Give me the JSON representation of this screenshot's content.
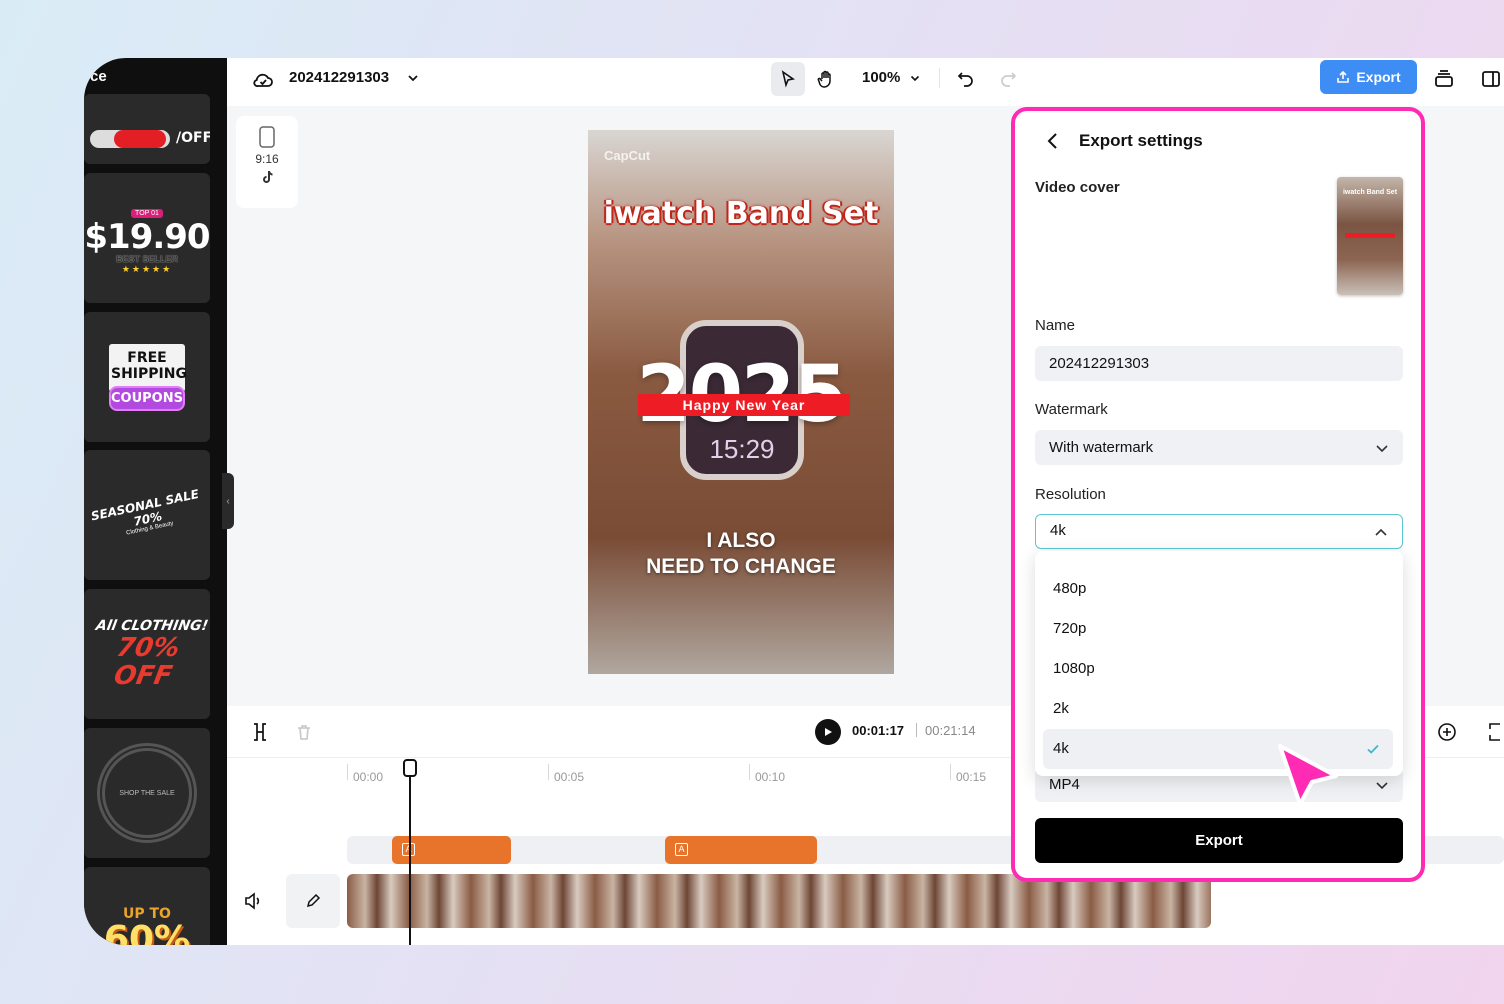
{
  "brand_fragment": "ce",
  "assets": [
    {
      "line1": "/OFF",
      "line2": ""
    },
    {
      "line1": "$19.90",
      "line2": "BEST SELLER"
    },
    {
      "line1": "FREE SHIPPING",
      "line2": "COUPONS"
    },
    {
      "line1": "SEASONAL SALE 70%",
      "line2": "Clothing & Beauty"
    },
    {
      "line1": "All CLOTHING!",
      "line2": "70% OFF"
    },
    {
      "line1": "SHOP THE SALE",
      "line2": ""
    },
    {
      "line1": "UP TO",
      "line2": "60%"
    }
  ],
  "topbar": {
    "project_name": "202412291303",
    "zoom": "100%",
    "export_label": "Export"
  },
  "ratio": {
    "label": "9:16"
  },
  "preview": {
    "watermark": "CapCut",
    "title": "iwatch Band Set",
    "year": "2025",
    "banner": "Happy New Year",
    "watch_time": "15:29",
    "caption_line1": "I ALSO",
    "caption_line2": "NEED TO CHANGE"
  },
  "timeline": {
    "current_time": "00:01:17",
    "total_time": "00:21:14",
    "ruler": [
      "00:00",
      "00:05",
      "00:10",
      "00:15"
    ]
  },
  "export_panel": {
    "title": "Export settings",
    "video_cover_label": "Video cover",
    "name_label": "Name",
    "name_value": "202412291303",
    "watermark_label": "Watermark",
    "watermark_value": "With watermark",
    "resolution_label": "Resolution",
    "resolution_value": "4k",
    "resolution_options": [
      "480p",
      "720p",
      "1080p",
      "2k",
      "4k"
    ],
    "format_value": "MP4",
    "export_label": "Export"
  },
  "colors": {
    "accent_pink": "#ff2bb4",
    "export_blue": "#3d8df5",
    "clip_orange": "#e8732a",
    "check_cyan": "#3fb8c6"
  }
}
